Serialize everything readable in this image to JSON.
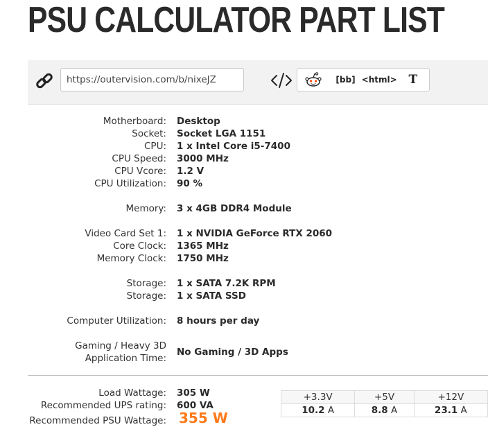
{
  "page": {
    "title": "PSU CALCULATOR PART LIST"
  },
  "share": {
    "url": "https://outervision.com/b/nixeJZ",
    "buttons": {
      "bb": "[bb]",
      "html": "<html>",
      "text": "T"
    }
  },
  "specs": [
    {
      "label": "Motherboard:",
      "value": "Desktop"
    },
    {
      "label": "Socket:",
      "value": "Socket LGA 1151"
    },
    {
      "label": "CPU:",
      "value": "1 x Intel Core i5-7400"
    },
    {
      "label": "CPU Speed:",
      "value": "3000 MHz"
    },
    {
      "label": "CPU Vcore:",
      "value": "1.2 V"
    },
    {
      "label": "CPU Utilization:",
      "value": "90 %"
    },
    {
      "label": "Memory:",
      "value": "3 x 4GB DDR4 Module"
    },
    {
      "label": "Video Card Set 1:",
      "value": "1 x NVIDIA GeForce RTX 2060"
    },
    {
      "label": "Core Clock:",
      "value": "1365 MHz"
    },
    {
      "label": "Memory Clock:",
      "value": "1750 MHz"
    },
    {
      "label": "Storage:",
      "value": "1 x SATA 7.2K RPM"
    },
    {
      "label": "Storage:",
      "value": "1 x SATA SSD"
    },
    {
      "label": "Computer Utilization:",
      "value": "8 hours per day"
    },
    {
      "label": "Gaming / Heavy 3D",
      "label2": "Application Time:",
      "value": "No Gaming / 3D Apps"
    }
  ],
  "results": {
    "load_wattage_label": "Load Wattage:",
    "load_wattage_value": "305 W",
    "ups_label": "Recommended UPS rating:",
    "ups_value": "600 VA",
    "psu_label": "Recommended PSU Wattage:",
    "psu_value": "355 W"
  },
  "rails": {
    "headers": [
      "+3.3V",
      "+5V",
      "+12V"
    ],
    "values": [
      "10.2",
      "8.8",
      "23.1"
    ],
    "unit": "A"
  }
}
